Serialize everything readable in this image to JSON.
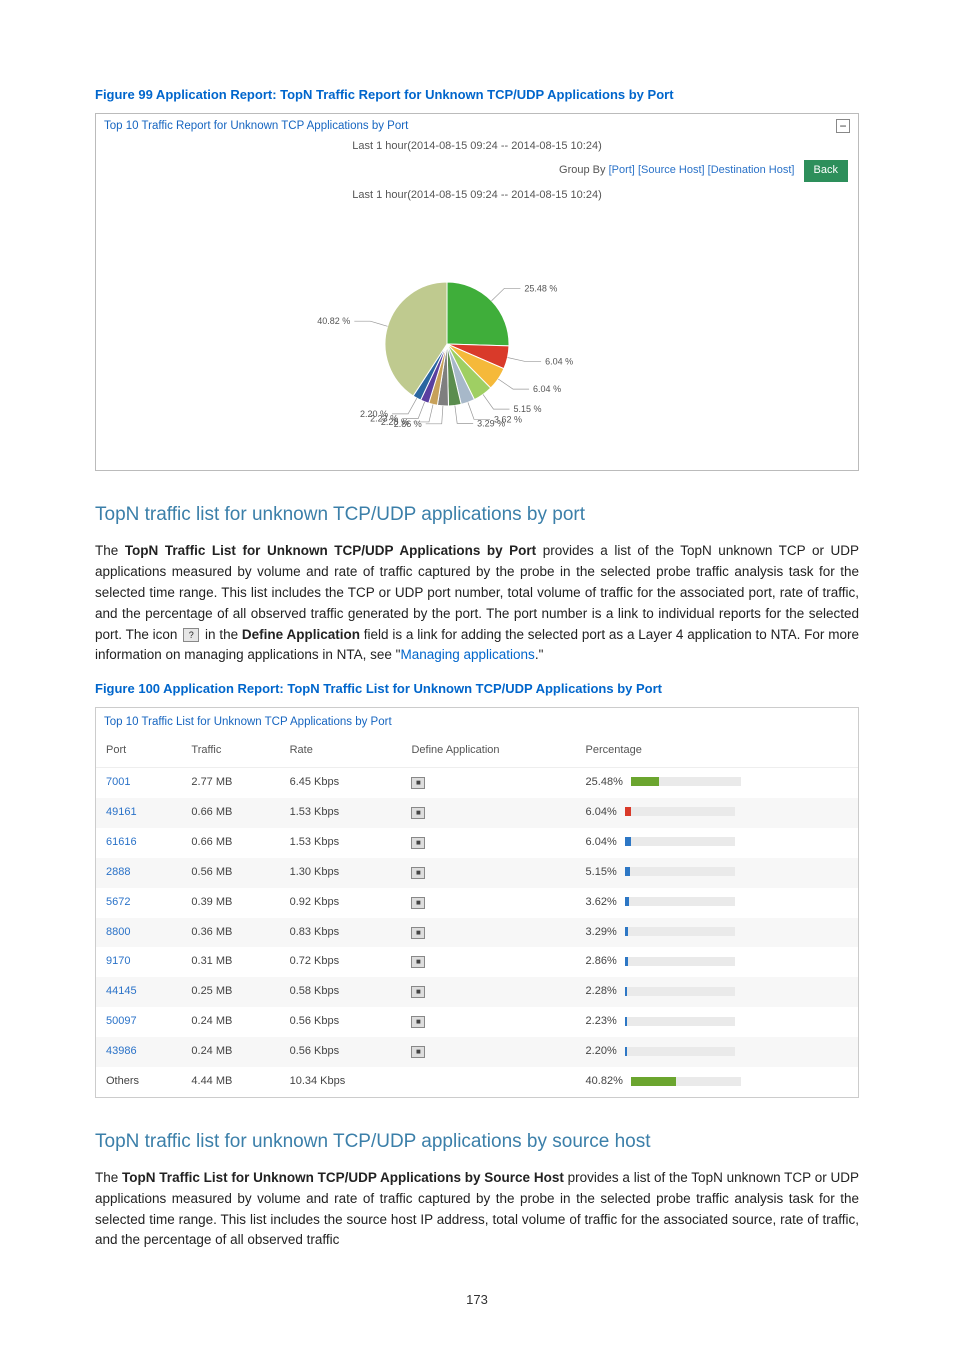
{
  "figure99": {
    "caption": "Figure 99 Application Report: TopN Traffic Report for Unknown TCP/UDP Applications by Port",
    "report_title": "Top 10 Traffic Report for Unknown TCP Applications by Port",
    "time_header": "Last 1 hour(2014-08-15 09:24 -- 2014-08-15 10:24)",
    "group_by_label": "Group By",
    "gb_port": "[Port]",
    "gb_src": "[Source Host]",
    "gb_dst": "[Destination Host]",
    "back": "Back",
    "pie_time": "Last 1 hour(2014-08-15 09:24 -- 2014-08-15 10:24)"
  },
  "chart_data": {
    "type": "pie",
    "title": "Last 1 hour(2014-08-15 09:24 -- 2014-08-15 10:24)",
    "slices": [
      {
        "label": "25.48 %",
        "value": 25.48,
        "color": "#3fae3a"
      },
      {
        "label": "6.04 %",
        "value": 6.04,
        "color": "#d93a2a"
      },
      {
        "label": "6.04 %",
        "value": 6.04,
        "color": "#f5b93a"
      },
      {
        "label": "5.15 %",
        "value": 5.15,
        "color": "#9fcf63"
      },
      {
        "label": "3.62 %",
        "value": 3.62,
        "color": "#a7b8c9"
      },
      {
        "label": "3.29 %",
        "value": 3.29,
        "color": "#5b8d4e"
      },
      {
        "label": "2.86 %",
        "value": 2.86,
        "color": "#7f7f7f"
      },
      {
        "label": "2.28 %",
        "value": 2.28,
        "color": "#c7a15a"
      },
      {
        "label": "2.23 %",
        "value": 2.23,
        "color": "#5a3fa0"
      },
      {
        "label": "2.20 %",
        "value": 2.2,
        "color": "#2a66a0"
      },
      {
        "label": "40.82 %",
        "value": 40.82,
        "color": "#bfca8f"
      }
    ]
  },
  "section1": {
    "heading": "TopN traffic list for unknown TCP/UDP applications by port",
    "p_prefix": "The ",
    "p_bold1": "TopN Traffic List for Unknown TCP/UDP Applications by Port",
    "p_after1": " provides a list of the TopN unknown TCP or UDP applications measured by volume and rate of traffic captured by the probe in the selected probe traffic analysis task for the selected time range. This list includes the TCP or UDP port number, total volume of traffic for the associated port, rate of traffic, and the percentage of all observed traffic generated by the port. The port number is a link to individual reports for the selected port. The icon ",
    "p_after_icon": " in the ",
    "p_bold2": "Define Application",
    "p_after2": " field is a link for adding the selected port as a Layer 4 application to NTA. For more information on managing applications in NTA, see \"",
    "p_link": "Managing applications",
    "p_end": ".\""
  },
  "figure100": {
    "caption": "Figure 100 Application Report: TopN Traffic List for Unknown TCP/UDP Applications by Port",
    "table_title": "Top 10 Traffic List for Unknown TCP Applications by Port",
    "headers": {
      "port": "Port",
      "traffic": "Traffic",
      "rate": "Rate",
      "def": "Define Application",
      "pct": "Percentage"
    },
    "rows": [
      {
        "port": "7001",
        "traffic": "2.77 MB",
        "rate": "6.45 Kbps",
        "pct": "25.48%",
        "pctv": 25.48,
        "color": "#6ba52f",
        "link": true
      },
      {
        "port": "49161",
        "traffic": "0.66 MB",
        "rate": "1.53 Kbps",
        "pct": "6.04%",
        "pctv": 6.04,
        "color": "#d93a2a",
        "link": true
      },
      {
        "port": "61616",
        "traffic": "0.66 MB",
        "rate": "1.53 Kbps",
        "pct": "6.04%",
        "pctv": 6.04,
        "color": "#2d77c5",
        "link": true
      },
      {
        "port": "2888",
        "traffic": "0.56 MB",
        "rate": "1.30 Kbps",
        "pct": "5.15%",
        "pctv": 5.15,
        "color": "#2d77c5",
        "link": true
      },
      {
        "port": "5672",
        "traffic": "0.39 MB",
        "rate": "0.92 Kbps",
        "pct": "3.62%",
        "pctv": 3.62,
        "color": "#2d77c5",
        "link": true
      },
      {
        "port": "8800",
        "traffic": "0.36 MB",
        "rate": "0.83 Kbps",
        "pct": "3.29%",
        "pctv": 3.29,
        "color": "#2d77c5",
        "link": true
      },
      {
        "port": "9170",
        "traffic": "0.31 MB",
        "rate": "0.72 Kbps",
        "pct": "2.86%",
        "pctv": 2.86,
        "color": "#2d77c5",
        "link": true
      },
      {
        "port": "44145",
        "traffic": "0.25 MB",
        "rate": "0.58 Kbps",
        "pct": "2.28%",
        "pctv": 2.28,
        "color": "#2d77c5",
        "link": true
      },
      {
        "port": "50097",
        "traffic": "0.24 MB",
        "rate": "0.56 Kbps",
        "pct": "2.23%",
        "pctv": 2.23,
        "color": "#2d77c5",
        "link": true
      },
      {
        "port": "43986",
        "traffic": "0.24 MB",
        "rate": "0.56 Kbps",
        "pct": "2.20%",
        "pctv": 2.2,
        "color": "#2d77c5",
        "link": true
      },
      {
        "port": "Others",
        "traffic": "4.44 MB",
        "rate": "10.34 Kbps",
        "pct": "40.82%",
        "pctv": 40.82,
        "color": "#6ba52f",
        "link": false
      }
    ]
  },
  "section2": {
    "heading": "TopN traffic list for unknown TCP/UDP applications by source host",
    "p_prefix": "The ",
    "p_bold1": "TopN Traffic List for Unknown TCP/UDP Applications by Source Host",
    "p_after1": " provides a list of the TopN unknown TCP or UDP applications measured by volume and rate of traffic captured by the probe in the selected probe traffic analysis task for the selected time range. This list includes the source host IP address, total volume of traffic for the associated source, rate of traffic, and the percentage of all observed traffic"
  },
  "page_number": "173"
}
